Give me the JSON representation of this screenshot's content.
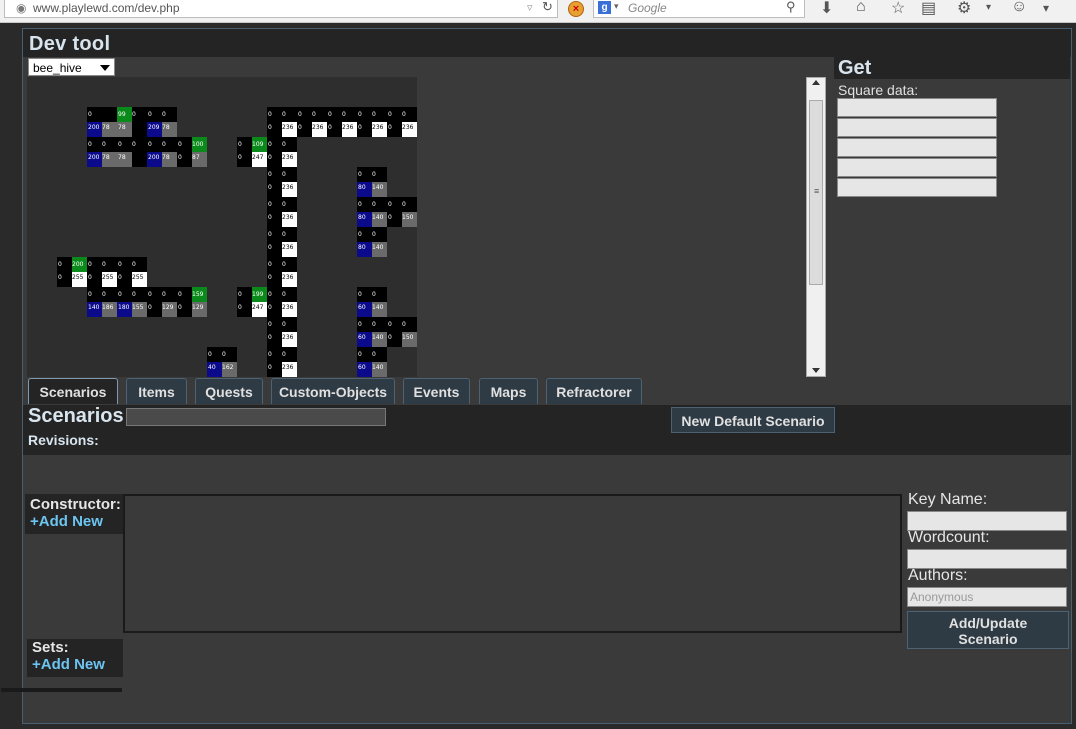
{
  "browser": {
    "url": "www.playlewd.com/dev.php",
    "search_placeholder": "Google",
    "search_engine_letter": "g"
  },
  "dev_tool": {
    "title": "Dev tool",
    "map_select_value": "bee_hive"
  },
  "map_tiles": [
    {
      "c": [
        0,
        1
      ],
      "v": [
        "0",
        "",
        "200",
        "78"
      ],
      "q": [
        "k",
        "k",
        "b",
        "g"
      ]
    },
    {
      "c": [
        1,
        1
      ],
      "v": [
        "99",
        "0",
        "78",
        ""
      ],
      "q": [
        "G",
        "k",
        "g",
        "k"
      ]
    },
    {
      "c": [
        2,
        1
      ],
      "v": [
        "0",
        "0",
        "209",
        "78"
      ],
      "q": [
        "k",
        "k",
        "b",
        "g"
      ]
    },
    {
      "c": [
        0,
        2
      ],
      "v": [
        "0",
        "0",
        "200",
        "78"
      ],
      "q": [
        "k",
        "k",
        "b",
        "g"
      ]
    },
    {
      "c": [
        1,
        2
      ],
      "v": [
        "0",
        "0",
        "78",
        ""
      ],
      "q": [
        "k",
        "k",
        "g",
        "k"
      ]
    },
    {
      "c": [
        2,
        2
      ],
      "v": [
        "0",
        "0",
        "200",
        "78"
      ],
      "q": [
        "k",
        "k",
        "b",
        "g"
      ]
    },
    {
      "c": [
        3,
        2
      ],
      "v": [
        "0",
        "100",
        "0",
        "87"
      ],
      "q": [
        "k",
        "G",
        "k",
        "g"
      ]
    },
    {
      "c": [
        5,
        2
      ],
      "v": [
        "0",
        "109",
        "0",
        "247"
      ],
      "q": [
        "k",
        "G",
        "k",
        "w"
      ]
    },
    {
      "c": [
        6,
        1
      ],
      "v": [
        "0",
        "0",
        "0",
        "236"
      ],
      "q": [
        "k",
        "k",
        "k",
        "w"
      ]
    },
    {
      "c": [
        7,
        1
      ],
      "v": [
        "0",
        "0",
        "0",
        "236"
      ],
      "q": [
        "k",
        "k",
        "k",
        "w"
      ]
    },
    {
      "c": [
        8,
        1
      ],
      "v": [
        "0",
        "0",
        "0",
        "236"
      ],
      "q": [
        "k",
        "k",
        "k",
        "w"
      ]
    },
    {
      "c": [
        9,
        1
      ],
      "v": [
        "0",
        "0",
        "0",
        "236"
      ],
      "q": [
        "k",
        "k",
        "k",
        "w"
      ]
    },
    {
      "c": [
        10,
        1
      ],
      "v": [
        "0",
        "0",
        "0",
        "236"
      ],
      "q": [
        "k",
        "k",
        "k",
        "w"
      ]
    },
    {
      "c": [
        11,
        1
      ],
      "v": [
        "0",
        "0",
        "0",
        "236"
      ],
      "q": [
        "k",
        "k",
        "k",
        "w"
      ]
    },
    {
      "c": [
        6,
        2
      ],
      "v": [
        "0",
        "0",
        "0",
        "236"
      ],
      "q": [
        "k",
        "k",
        "k",
        "w"
      ]
    },
    {
      "c": [
        11,
        2
      ],
      "v": [
        "0",
        "0",
        "0",
        "236"
      ],
      "q": [
        "k",
        "k",
        "k",
        "w"
      ]
    },
    {
      "c": [
        6,
        3
      ],
      "v": [
        "0",
        "0",
        "0",
        "236"
      ],
      "q": [
        "k",
        "k",
        "k",
        "w"
      ]
    },
    {
      "c": [
        9,
        3
      ],
      "v": [
        "0",
        "0",
        "80",
        "140"
      ],
      "q": [
        "k",
        "k",
        "b",
        "g"
      ]
    },
    {
      "c": [
        11,
        3
      ],
      "v": [
        "0",
        "0",
        "0",
        "236"
      ],
      "q": [
        "k",
        "k",
        "k",
        "w"
      ]
    },
    {
      "c": [
        6,
        4
      ],
      "v": [
        "0",
        "0",
        "0",
        "236"
      ],
      "q": [
        "k",
        "k",
        "k",
        "w"
      ]
    },
    {
      "c": [
        9,
        4
      ],
      "v": [
        "0",
        "0",
        "80",
        "140"
      ],
      "q": [
        "k",
        "k",
        "b",
        "g"
      ]
    },
    {
      "c": [
        10,
        4
      ],
      "v": [
        "0",
        "0",
        "0",
        "150"
      ],
      "q": [
        "k",
        "k",
        "k",
        "g"
      ]
    },
    {
      "c": [
        11,
        4
      ],
      "v": [
        "0",
        "0",
        "0",
        "236"
      ],
      "q": [
        "k",
        "k",
        "k",
        "w"
      ]
    },
    {
      "c": [
        6,
        5
      ],
      "v": [
        "0",
        "0",
        "0",
        "236"
      ],
      "q": [
        "k",
        "k",
        "k",
        "w"
      ]
    },
    {
      "c": [
        9,
        5
      ],
      "v": [
        "0",
        "0",
        "80",
        "140"
      ],
      "q": [
        "k",
        "k",
        "b",
        "g"
      ]
    },
    {
      "c": [
        11,
        5
      ],
      "v": [
        "0",
        "0",
        "0",
        "236"
      ],
      "q": [
        "k",
        "k",
        "k",
        "w"
      ]
    },
    {
      "c": [
        -1,
        6
      ],
      "v": [
        "0",
        "200",
        "0",
        "255"
      ],
      "q": [
        "k",
        "G",
        "k",
        "w"
      ]
    },
    {
      "c": [
        0,
        6
      ],
      "v": [
        "0",
        "0",
        "0",
        "255"
      ],
      "q": [
        "k",
        "k",
        "k",
        "w"
      ]
    },
    {
      "c": [
        1,
        6
      ],
      "v": [
        "0",
        "0",
        "0",
        "255"
      ],
      "q": [
        "k",
        "k",
        "k",
        "w"
      ]
    },
    {
      "c": [
        6,
        6
      ],
      "v": [
        "0",
        "0",
        "0",
        "236"
      ],
      "q": [
        "k",
        "k",
        "k",
        "w"
      ]
    },
    {
      "c": [
        11,
        6
      ],
      "v": [
        "0",
        "0",
        "0",
        "236"
      ],
      "q": [
        "k",
        "k",
        "k",
        "w"
      ]
    },
    {
      "c": [
        0,
        7
      ],
      "v": [
        "0",
        "0",
        "140",
        "186"
      ],
      "q": [
        "k",
        "k",
        "b",
        "g"
      ]
    },
    {
      "c": [
        1,
        7
      ],
      "v": [
        "0",
        "0",
        "180",
        "155"
      ],
      "q": [
        "k",
        "k",
        "b",
        "g"
      ]
    },
    {
      "c": [
        2,
        7
      ],
      "v": [
        "0",
        "0",
        "0",
        "129"
      ],
      "q": [
        "k",
        "k",
        "k",
        "g"
      ]
    },
    {
      "c": [
        3,
        7
      ],
      "v": [
        "0",
        "159",
        "0",
        "129"
      ],
      "q": [
        "k",
        "G",
        "k",
        "g"
      ]
    },
    {
      "c": [
        5,
        7
      ],
      "v": [
        "0",
        "199",
        "0",
        "247"
      ],
      "q": [
        "k",
        "G",
        "k",
        "w"
      ]
    },
    {
      "c": [
        6,
        7
      ],
      "v": [
        "0",
        "0",
        "0",
        "236"
      ],
      "q": [
        "k",
        "k",
        "k",
        "w"
      ]
    },
    {
      "c": [
        9,
        7
      ],
      "v": [
        "0",
        "0",
        "60",
        "140"
      ],
      "q": [
        "k",
        "k",
        "b",
        "g"
      ]
    },
    {
      "c": [
        11,
        7
      ],
      "v": [
        "0",
        "0",
        "0",
        "236"
      ],
      "q": [
        "k",
        "k",
        "k",
        "w"
      ]
    },
    {
      "c": [
        6,
        8
      ],
      "v": [
        "0",
        "0",
        "0",
        "236"
      ],
      "q": [
        "k",
        "k",
        "k",
        "w"
      ]
    },
    {
      "c": [
        9,
        8
      ],
      "v": [
        "0",
        "0",
        "60",
        "140"
      ],
      "q": [
        "k",
        "k",
        "b",
        "g"
      ]
    },
    {
      "c": [
        10,
        8
      ],
      "v": [
        "0",
        "0",
        "0",
        "150"
      ],
      "q": [
        "k",
        "k",
        "k",
        "g"
      ]
    },
    {
      "c": [
        11,
        8
      ],
      "v": [
        "0",
        "0",
        "0",
        "236"
      ],
      "q": [
        "k",
        "k",
        "k",
        "w"
      ]
    },
    {
      "c": [
        4,
        9
      ],
      "v": [
        "0",
        "0",
        "40",
        "162"
      ],
      "q": [
        "k",
        "k",
        "b",
        "g"
      ]
    },
    {
      "c": [
        6,
        9
      ],
      "v": [
        "0",
        "0",
        "0",
        "236"
      ],
      "q": [
        "k",
        "k",
        "k",
        "w"
      ]
    },
    {
      "c": [
        9,
        9
      ],
      "v": [
        "0",
        "0",
        "60",
        "140"
      ],
      "q": [
        "k",
        "k",
        "b",
        "g"
      ]
    },
    {
      "c": [
        11,
        9
      ],
      "v": [
        "0",
        "0",
        "0",
        "236"
      ],
      "q": [
        "k",
        "k",
        "k",
        "w"
      ]
    }
  ],
  "get_panel": {
    "title": "Get",
    "square_data_label": "Square data:"
  },
  "tabs": [
    {
      "label": "Scenarios",
      "active": true
    },
    {
      "label": "Items",
      "active": false
    },
    {
      "label": "Quests",
      "active": false
    },
    {
      "label": "Custom-Objects",
      "active": false
    },
    {
      "label": "Events",
      "active": false
    },
    {
      "label": "Maps",
      "active": false
    },
    {
      "label": "Refractorer",
      "active": false
    }
  ],
  "scenarios": {
    "title": "Scenarios",
    "revisions_label": "Revisions:",
    "new_default_button": "New Default Scenario",
    "constructor_label": "Constructor:",
    "constructor_add": "+Add New",
    "sets_label": "Sets:",
    "sets_add": "+Add New",
    "key_name_label": "Key Name:",
    "wordcount_label": "Wordcount:",
    "authors_label": "Authors:",
    "authors_placeholder": "Anonymous",
    "add_update_button_line1": "Add/Update",
    "add_update_button_line2": "Scenario"
  },
  "colors": {
    "quadrant_black": "#000000",
    "quadrant_blue": "#0a0a8a",
    "quadrant_gray": "#6a6a6a",
    "quadrant_white": "#ffffff",
    "quadrant_green": "#0a8a1a",
    "accent_link": "#6cc4f0"
  }
}
